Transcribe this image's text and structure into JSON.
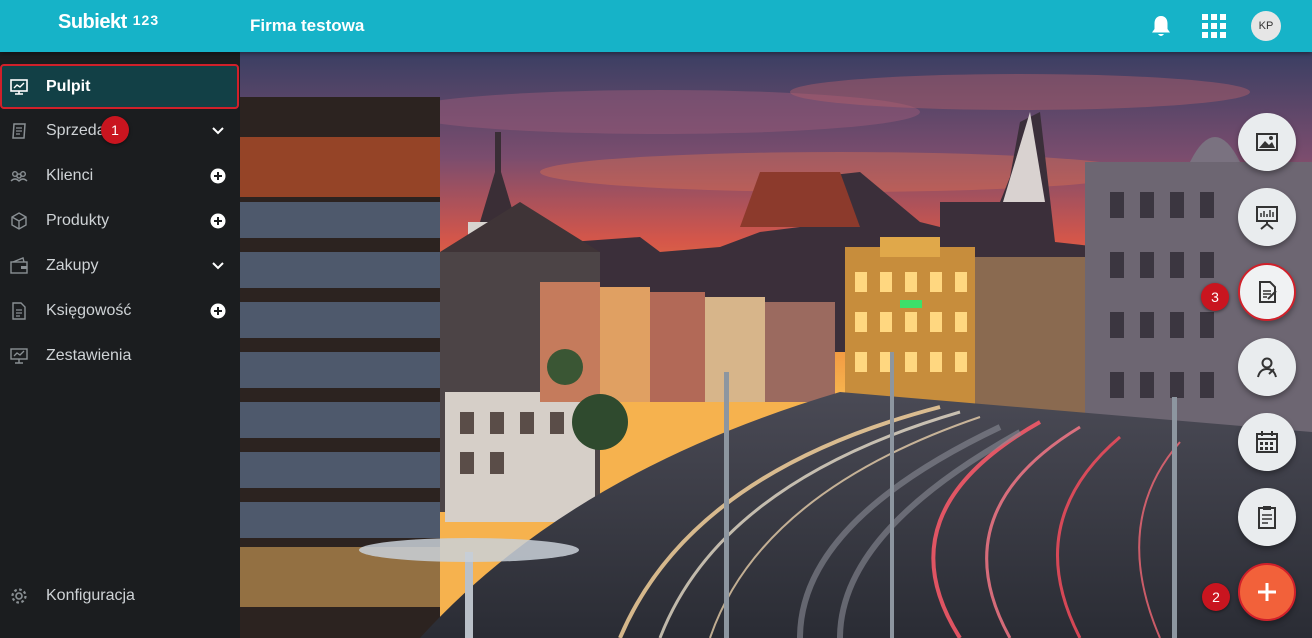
{
  "header": {
    "logo_text": "Subiekt",
    "logo_suffix": "123",
    "company_name": "Firma testowa",
    "avatar_initials": "KP"
  },
  "sidebar": {
    "items": [
      {
        "label": "Pulpit",
        "icon": "dashboard-icon",
        "action": "none"
      },
      {
        "label": "Sprzedaż",
        "icon": "sales-icon",
        "action": "chevron-down-icon"
      },
      {
        "label": "Klienci",
        "icon": "clients-icon",
        "action": "plus-circle-icon"
      },
      {
        "label": "Produkty",
        "icon": "box-icon",
        "action": "plus-circle-icon"
      },
      {
        "label": "Zakupy",
        "icon": "wallet-icon",
        "action": "chevron-down-icon"
      },
      {
        "label": "Księgowość",
        "icon": "document-icon",
        "action": "plus-circle-icon"
      },
      {
        "label": "Zestawienia",
        "icon": "presentation-icon",
        "action": "none"
      }
    ],
    "settings_label": "Konfiguracja"
  },
  "badges": {
    "one": "1",
    "two": "2",
    "three": "3"
  },
  "fabs": [
    "image-icon",
    "presentation-board-icon",
    "document-edit-icon",
    "contact-icon",
    "calendar-icon",
    "clipboard-icon",
    "plus-icon"
  ],
  "colors": {
    "topbar": "#16b3c8",
    "sidebar": "#1b1d1f",
    "active_item": "#124046",
    "highlight_border": "#d0202a",
    "fab_add": "#f2613a"
  }
}
